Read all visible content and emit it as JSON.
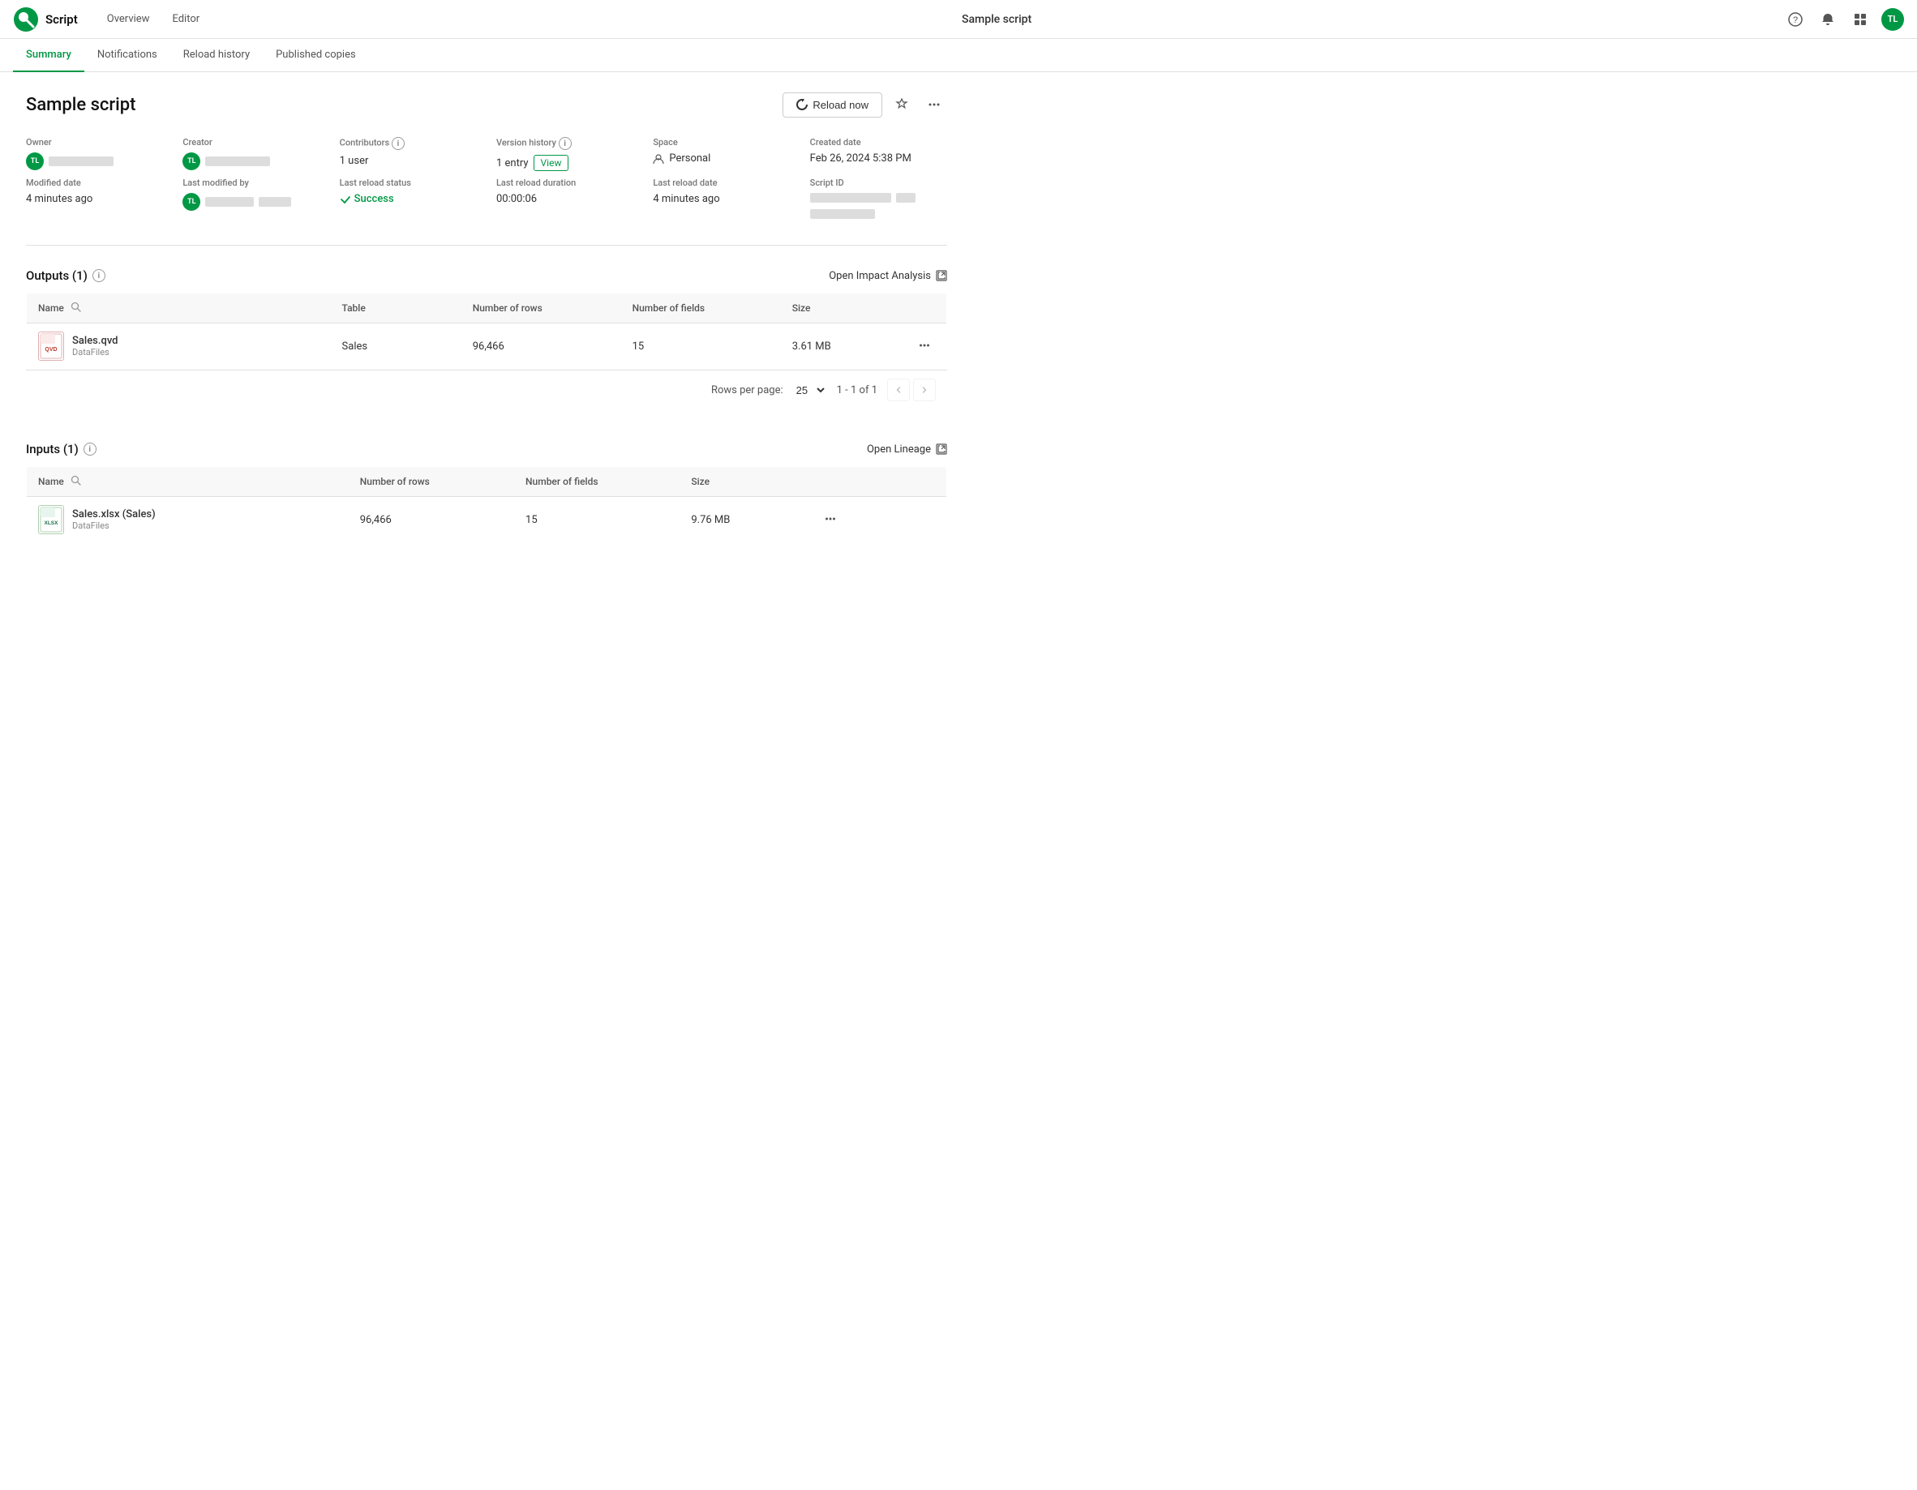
{
  "topbar": {
    "logo_label": "Qlik",
    "app_name": "Script",
    "nav": [
      {
        "id": "overview",
        "label": "Overview"
      },
      {
        "id": "editor",
        "label": "Editor"
      }
    ],
    "center_title": "Sample script",
    "actions": {
      "help_icon": "?",
      "bell_icon": "🔔",
      "grid_icon": "⊞",
      "avatar_initials": "TL"
    }
  },
  "tabs": [
    {
      "id": "summary",
      "label": "Summary",
      "active": true
    },
    {
      "id": "notifications",
      "label": "Notifications",
      "active": false
    },
    {
      "id": "reload_history",
      "label": "Reload history",
      "active": false
    },
    {
      "id": "published_copies",
      "label": "Published copies",
      "active": false
    }
  ],
  "page": {
    "title": "Sample script",
    "reload_button_label": "Reload now",
    "metadata": {
      "row1": [
        {
          "id": "owner",
          "label": "Owner",
          "type": "avatar_blur",
          "initials": "TL"
        },
        {
          "id": "creator",
          "label": "Creator",
          "type": "avatar_blur",
          "initials": "TL"
        },
        {
          "id": "contributors",
          "label": "Contributors",
          "type": "text",
          "value": "1 user"
        },
        {
          "id": "version_history",
          "label": "Version history",
          "type": "view_link",
          "value": "1 entry",
          "link_label": "View"
        },
        {
          "id": "space",
          "label": "Space",
          "type": "text_icon",
          "icon": "person",
          "value": "Personal"
        },
        {
          "id": "created_date",
          "label": "Created date",
          "type": "text",
          "value": "Feb 26, 2024 5:38 PM"
        }
      ],
      "row2": [
        {
          "id": "modified_date",
          "label": "Modified date",
          "type": "text",
          "value": "4 minutes ago"
        },
        {
          "id": "last_modified_by",
          "label": "Last modified by",
          "type": "avatar_blur",
          "initials": "TL"
        },
        {
          "id": "last_reload_status",
          "label": "Last reload status",
          "type": "status",
          "value": "Success"
        },
        {
          "id": "last_reload_duration",
          "label": "Last reload duration",
          "type": "text",
          "value": "00:00:06"
        },
        {
          "id": "last_reload_date",
          "label": "Last reload date",
          "type": "text",
          "value": "4 minutes ago"
        },
        {
          "id": "script_id",
          "label": "Script ID",
          "type": "blur_only"
        }
      ]
    },
    "outputs": {
      "section_title": "Outputs (1)",
      "open_impact_label": "Open Impact Analysis",
      "table_headers": [
        "Name",
        "Table",
        "Number of rows",
        "Number of fields",
        "Size"
      ],
      "rows_per_page_label": "Rows per page:",
      "rows_per_page_value": "25",
      "pagination_info": "1 - 1 of 1",
      "rows": [
        {
          "file_name": "Sales.qvd",
          "file_subfolder": "DataFiles",
          "file_type": "qvd",
          "table": "Sales",
          "num_rows": "96,466",
          "num_fields": "15",
          "size": "3.61 MB"
        }
      ]
    },
    "inputs": {
      "section_title": "Inputs (1)",
      "open_lineage_label": "Open Lineage",
      "table_headers": [
        "Name",
        "Number of rows",
        "Number of fields",
        "Size"
      ],
      "rows": [
        {
          "file_name": "Sales.xlsx (Sales)",
          "file_subfolder": "DataFiles",
          "file_type": "xlsx",
          "num_rows": "96,466",
          "num_fields": "15",
          "size": "9.76 MB"
        }
      ]
    }
  }
}
